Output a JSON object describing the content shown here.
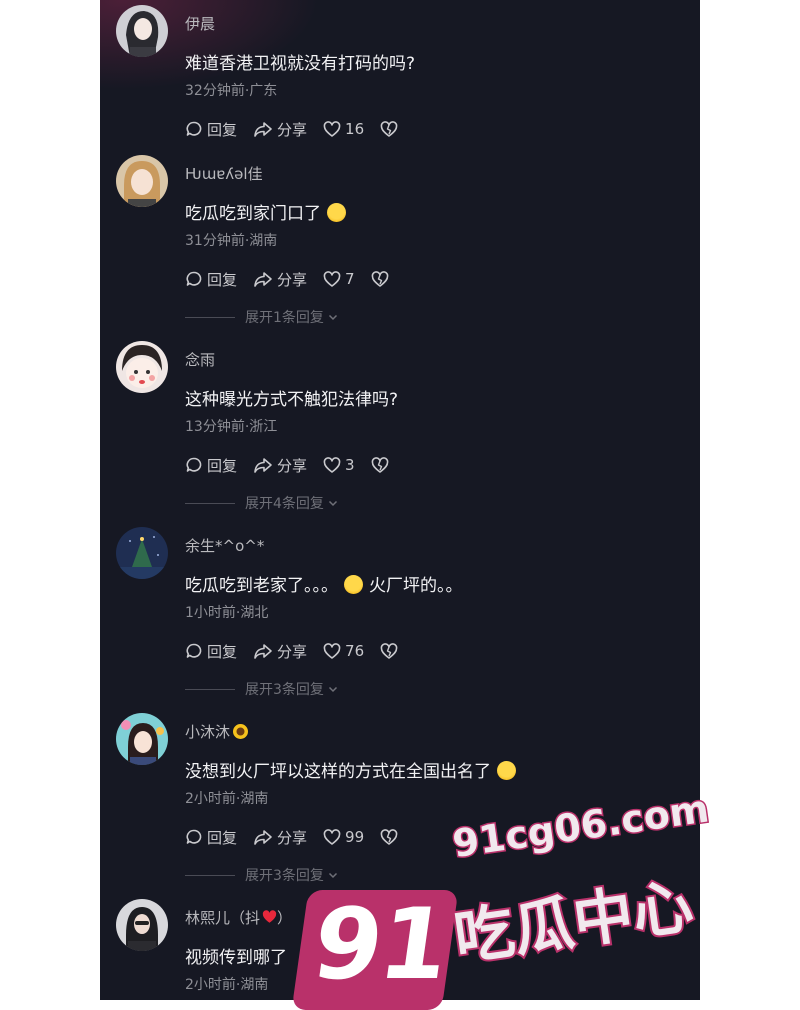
{
  "actions": {
    "reply": "回复",
    "share": "分享"
  },
  "comments": [
    {
      "name": "伊晨",
      "text": "难道香港卫视就没有打码的吗?",
      "meta": "32分钟前·广东",
      "likes": "16",
      "expand": ""
    },
    {
      "name": "Ƕɯɐʎǝl佳",
      "text": "吃瓜吃到家门口了",
      "meta": "31分钟前·湖南",
      "likes": "7",
      "expand": "展开1条回复"
    },
    {
      "name": "念雨",
      "text": "这种曝光方式不触犯法律吗?",
      "meta": "13分钟前·浙江",
      "likes": "3",
      "expand": "展开4条回复"
    },
    {
      "name": "余生*^o^*",
      "text": "吃瓜吃到老家了。。。",
      "text2": "火厂坪的。。",
      "meta": "1小时前·湖北",
      "likes": "76",
      "expand": "展开3条回复"
    },
    {
      "name": "小沐沐",
      "text": "没想到火厂坪以这样的方式在全国出名了",
      "meta": "2小时前·湖南",
      "likes": "99",
      "expand": "展开3条回复"
    },
    {
      "name": "林熙儿（抖",
      "name_suffix": "）",
      "text": "视频传到哪了",
      "meta": "2小时前·湖南",
      "likes": "",
      "expand": ""
    }
  ],
  "watermark": {
    "big": "91",
    "domain": "91cg06.com",
    "cn": "吃瓜中心"
  },
  "colors": {
    "background": "#161823",
    "watermark": "#b9316a"
  },
  "icons": [
    "reply-icon",
    "share-icon",
    "heart-icon",
    "dislike-heart-icon",
    "chevron-down-icon",
    "laugh-emoji-icon",
    "sunflower-icon"
  ]
}
